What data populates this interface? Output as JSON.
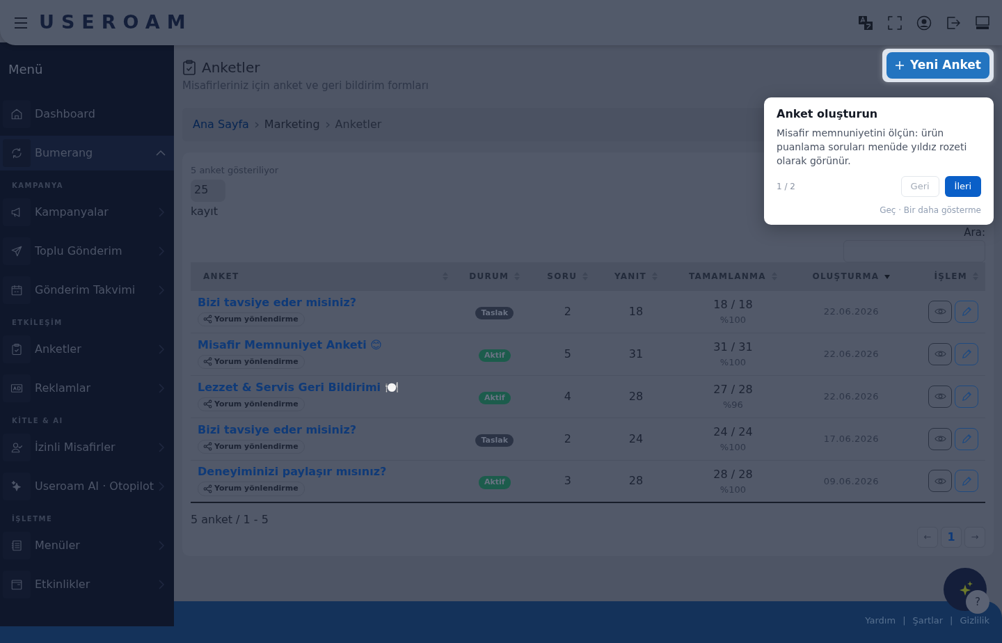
{
  "header": {
    "logo": "USEROAM"
  },
  "sidebar": {
    "title": "Menü",
    "items": [
      {
        "kind": "link",
        "label": "Dashboard",
        "selected": false
      },
      {
        "kind": "link",
        "label": "Bumerang",
        "selected": true,
        "expanded": true
      },
      {
        "kind": "heading",
        "label": "KAMPANYA"
      },
      {
        "kind": "link",
        "label": "Kampanyalar",
        "selected": false,
        "expanded": false
      },
      {
        "kind": "link",
        "label": "Toplu Gönderim",
        "selected": false,
        "expanded": false
      },
      {
        "kind": "link",
        "label": "Gönderim Takvimi",
        "selected": false,
        "expanded": false
      },
      {
        "kind": "heading",
        "label": "ETKİLEŞİM"
      },
      {
        "kind": "link",
        "label": "Anketler",
        "selected": false,
        "expanded": false
      },
      {
        "kind": "link",
        "label": "Reklamlar",
        "selected": false,
        "expanded": false
      },
      {
        "kind": "heading",
        "label": "KİTLE & AI"
      },
      {
        "kind": "link",
        "label": "İzinli Misafirler",
        "selected": false,
        "expanded": false
      },
      {
        "kind": "link",
        "label": "Useroam AI · Otopilot",
        "selected": false,
        "expanded": false
      },
      {
        "kind": "heading",
        "label": "İŞLETME"
      },
      {
        "kind": "link",
        "label": "Menüler",
        "selected": false,
        "expanded": false
      },
      {
        "kind": "link",
        "label": "Etkinlikler",
        "selected": false,
        "expanded": false
      }
    ]
  },
  "page": {
    "title": "Anketler",
    "subtitle": "Misafirleriniz için anket ve geri bildirim formları",
    "new_button": "Yeni Anket"
  },
  "breadcrumb": [
    "Ana Sayfa",
    "Marketing",
    "Anketler"
  ],
  "list": {
    "showing": "5 anket gösteriliyor",
    "page_size": "25",
    "page_size_label": "kayıt",
    "search_label": "Ara:"
  },
  "table": {
    "columns": [
      {
        "label": "ANKET",
        "sorted": false
      },
      {
        "label": "DURUM",
        "sorted": false
      },
      {
        "label": "SORU",
        "sorted": false
      },
      {
        "label": "YANIT",
        "sorted": false
      },
      {
        "label": "TAMAMLANMA",
        "sorted": false
      },
      {
        "label": "OLUŞTURMA",
        "sorted": true
      },
      {
        "label": "İŞLEM",
        "sorted": false
      }
    ],
    "rows": [
      {
        "title": "Bizi tavsiye eder misiniz?",
        "tag": "Yorum yönlendirme",
        "status": "Taslak",
        "color": "#2b3345",
        "questions": "2",
        "responses": "18",
        "completion": "18 / 18",
        "percent": "%100",
        "created": "22.06.2026"
      },
      {
        "title": "Misafir Memnuniyet Anketi 😊",
        "tag": "Yorum yönlendirme",
        "status": "Aktif",
        "color": "#1c5c4c",
        "questions": "5",
        "responses": "31",
        "completion": "31 / 31",
        "percent": "%100",
        "created": "22.06.2026"
      },
      {
        "title": "Lezzet & Servis Geri Bildirimi 🍽️",
        "tag": "Yorum yönlendirme",
        "status": "Aktif",
        "color": "#1c5c4c",
        "questions": "4",
        "responses": "28",
        "completion": "27 / 28",
        "percent": "%96",
        "created": "22.06.2026"
      },
      {
        "title": "Bizi tavsiye eder misiniz?",
        "tag": "Yorum yönlendirme",
        "status": "Taslak",
        "color": "#2b3345",
        "questions": "2",
        "responses": "24",
        "completion": "24 / 24",
        "percent": "%100",
        "created": "17.06.2026"
      },
      {
        "title": "Deneyiminizi paylaşır mısınız?",
        "tag": "Yorum yönlendirme",
        "status": "Aktif",
        "color": "#1c5c4c",
        "questions": "3",
        "responses": "28",
        "completion": "28 / 28",
        "percent": "%100",
        "created": "09.06.2026"
      }
    ]
  },
  "summary": "5 anket / 1 - 5",
  "pagination": {
    "prev": "←",
    "pages": [
      {
        "label": "1",
        "selected": true
      }
    ],
    "next": "→"
  },
  "tour": {
    "title": "Anket oluşturun",
    "body": "Misafir memnuniyetini ölçün: ürün puanlama soruları menüde yıldız rozeti olarak görünür.",
    "step": "1 / 2",
    "back": "Geri",
    "next": "İleri",
    "skip": "Geç · Bir daha gösterme"
  },
  "help_button": "?",
  "footer": [
    {
      "kind": "link",
      "text": "Yardım"
    },
    {
      "kind": "separator",
      "text": "|"
    },
    {
      "kind": "link",
      "text": "Şartlar"
    },
    {
      "kind": "separator",
      "text": "|"
    },
    {
      "kind": "link",
      "text": "Gizlilik"
    }
  ]
}
